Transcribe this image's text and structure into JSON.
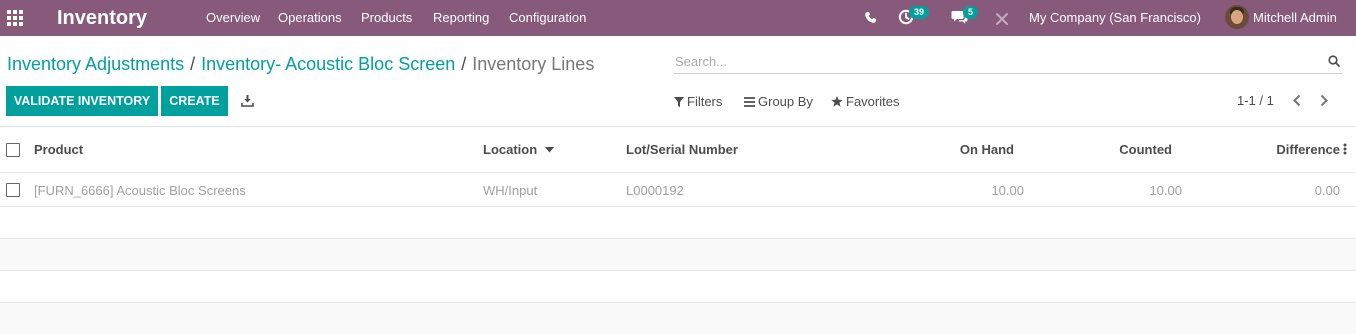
{
  "navbar": {
    "app_title": "Inventory",
    "menu": [
      "Overview",
      "Operations",
      "Products",
      "Reporting",
      "Configuration"
    ],
    "activity_count": "39",
    "messages_count": "5",
    "company": "My Company (San Francisco)",
    "user": "Mitchell Admin",
    "icons": [
      "apps-grid-icon",
      "phone-icon",
      "activity-clock-icon",
      "chat-icon",
      "debug-tools-icon"
    ],
    "bg_color": "#875a7b",
    "badge_color": "#00a09d"
  },
  "breadcrumb": {
    "level1": "Inventory Adjustments",
    "separator": "/",
    "level2": "Inventory- Acoustic Bloc Screen",
    "current": "Inventory Lines"
  },
  "search": {
    "placeholder": "Search..."
  },
  "buttons": {
    "validate": "VALIDATE INVENTORY",
    "create": "CREATE"
  },
  "filters": {
    "filters": "Filters",
    "group_by": "Group By",
    "favorites": "Favorites"
  },
  "pager": {
    "value": "1-1 / 1"
  },
  "table": {
    "columns": {
      "product": "Product",
      "location": "Location",
      "lot": "Lot/Serial Number",
      "on_hand": "On Hand",
      "counted": "Counted",
      "difference": "Difference"
    },
    "sorted_column": "Location",
    "rows": [
      {
        "product": "[FURN_6666] Acoustic Bloc Screens",
        "location": "WH/Input",
        "lot": "L0000192",
        "on_hand": "10.00",
        "counted": "10.00",
        "difference": "0.00"
      }
    ]
  },
  "accent_color": "#00a09d"
}
